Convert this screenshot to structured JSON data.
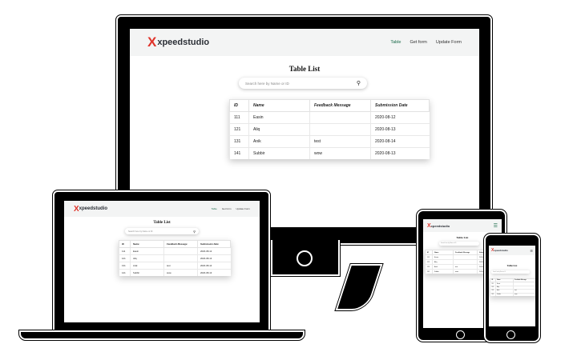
{
  "brand": {
    "logo_mark": "X",
    "logo_text": "xpeedstudio",
    "accent": "#e0342b",
    "nav_active_color": "#1b6b4a"
  },
  "nav": {
    "items": [
      {
        "label": "Table"
      },
      {
        "label": "Get form"
      },
      {
        "label": "Update Form"
      }
    ]
  },
  "page": {
    "title": "Table List",
    "search_placeholder": "Search here by Name or ID",
    "search_icon": "search-icon"
  },
  "table": {
    "columns": [
      "ID",
      "Name",
      "Feedback Message",
      "Submission Date"
    ],
    "rows": [
      [
        "111",
        "Easin",
        "",
        "2020-08-12"
      ],
      [
        "121",
        "Aliq",
        "",
        "2020-08-13"
      ],
      [
        "131",
        "Anik",
        "test",
        "2020-08-14"
      ],
      [
        "141",
        "Subbir",
        "wow",
        "2020-08-13"
      ]
    ]
  }
}
